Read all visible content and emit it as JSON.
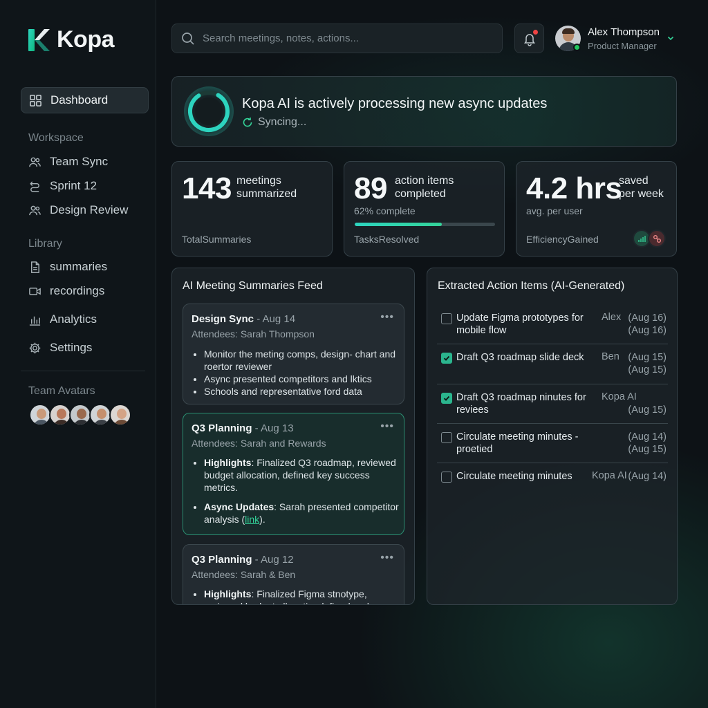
{
  "brand": {
    "name": "Kopa"
  },
  "sidebar": {
    "dashboard": "Dashboard",
    "workspace_label": "Workspace",
    "workspace": [
      "Team Sync",
      "Sprint 12",
      "Design Review"
    ],
    "library_label": "Library",
    "library": [
      "summaries",
      "recordings"
    ],
    "analytics": "Analytics",
    "settings": "Settings",
    "team_label": "Team Avatars"
  },
  "search": {
    "placeholder": "Search meetings, notes, actions..."
  },
  "user": {
    "name": "Alex Thompson",
    "role": "Product Manager"
  },
  "banner": {
    "title": "Kopa AI is actively processing new async updates",
    "status": "Syncing..."
  },
  "stats": [
    {
      "value": "143",
      "label_line1": "meetings",
      "label_line2": "summarized",
      "foot": "TotalSummaries"
    },
    {
      "value": "89",
      "label_line1": "action items",
      "label_line2": "completed",
      "sub": "62% complete",
      "progress": 0.62,
      "foot": "TasksResolved"
    },
    {
      "value": "4.2 hrs",
      "label_line1": "saved",
      "label_line2": "per week",
      "sub": "avg. per user",
      "foot": "EfficiencyGained"
    }
  ],
  "feed": {
    "title": "AI Meeting Summaries Feed",
    "cards": [
      {
        "title": "Design Sync",
        "date": " - Aug 14",
        "attendees": "Attendees: Sarah Thompson",
        "bullets": [
          "Monitor the meting comps, design- chart and roertor reviewer",
          "Async presented competitors and lktics",
          "Schools and representative ford data"
        ]
      },
      {
        "title": "Q3 Planning",
        "date": " - Aug 13",
        "attendees": "Attendees: Sarah and Rewards",
        "b1_label": "Highlights",
        "b1_text": ": Finalized Q3 roadmap, reviewed budget allocation, defined key success metrics.",
        "b2_label": "Async Updates",
        "b2_text": ": Sarah presented competitor analysis (",
        "b2_link": "link",
        "b2_end": ")."
      },
      {
        "title": "Q3 Planning",
        "date": " - Aug 12",
        "attendees": "Attendees: Sarah & Ben",
        "b1_label": "Highlights",
        "b1_text": ": Finalized Figma stnotype, reviewed budget allocatio, defined and"
      }
    ]
  },
  "actions": {
    "title": "Extracted Action Items (AI-Generated)",
    "items": [
      {
        "text": "Update Figma prototypes for mobile flow",
        "owner": "Alex",
        "date1": "(Aug 16)",
        "date2": "(Aug 16)",
        "checked": false
      },
      {
        "text": "Draft Q3 roadmap slide deck",
        "owner": "Ben",
        "date1": "(Aug 15)",
        "date2": "(Aug 15)",
        "checked": true
      },
      {
        "text": "Draft Q3 roadmap ninutes for reviees",
        "owner": "Kopa AI",
        "date1": "",
        "date2": "(Aug 15)",
        "checked": true
      },
      {
        "text": "Circulate meeting minutes - proetied",
        "owner": "",
        "date1": "(Aug 14)",
        "date2": "(Aug 15)",
        "checked": false
      },
      {
        "text": "Circulate meeting minutes",
        "owner": "Kopa AI",
        "date1": "(Aug 14)",
        "date2": "",
        "checked": false
      }
    ]
  },
  "colors": {
    "accent": "#34d399",
    "accent_teal": "#2dd4bf",
    "alert": "#ef4444",
    "online": "#22c55e"
  }
}
